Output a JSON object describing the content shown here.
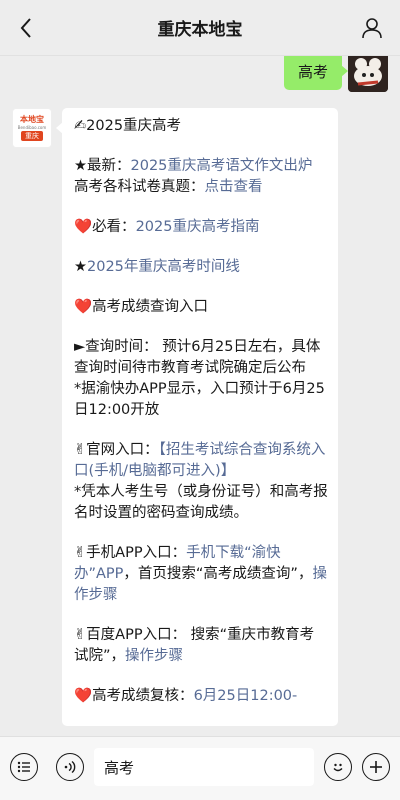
{
  "header": {
    "title": "重庆本地宝"
  },
  "user_message": {
    "text": "高考"
  },
  "bot_avatar": {
    "logo_text": "本地宝",
    "logo_site": "Bendibao.com",
    "logo_city": "重庆"
  },
  "reply": {
    "line1_icon": "✍",
    "line1": "2025重庆高考",
    "latest_prefix": "★最新：",
    "latest_link": "2025重庆高考语文作文出炉",
    "papers_prefix": "高考各科试卷真题：",
    "papers_link": "点击查看",
    "heart_icon": "❤️",
    "must_prefix": "必看：",
    "must_link": "2025重庆高考指南",
    "timeline_star": "★",
    "timeline_link": "2025年重庆高考时间线",
    "score_heading": "高考成绩查询入口",
    "query_time": "►查询时间：  预计6月25日左右，具体查询时间待市教育考试院确定后公布",
    "app_note": "*据渝快办APP显示，入口预计于6月25日12:00开放",
    "hand_icon": "✌",
    "official_prefix": "官网入口：",
    "official_link": "【招生考试综合查询系统入口(手机/电脑都可进入)】",
    "official_note": "*凭本人考生号（或身份证号）和高考报名时设置的密码查询成绩。",
    "mobile_prefix": "手机APP入口：",
    "mobile_link": "手机下载“渝快办”APP",
    "mobile_mid": "，首页搜索“高考成绩查询”，",
    "mobile_step": "操作步骤",
    "baidu_prefix": "百度APP入口：  搜索“重庆市教育考试院”，",
    "baidu_step": "操作步骤",
    "review_prefix": "高考成绩复核：",
    "review_link": "6月25日12:00-"
  },
  "input_bar": {
    "value": "高考"
  },
  "colors": {
    "background": "#ededed",
    "user_bubble": "#95ec69",
    "link": "#576b95",
    "heart": "#e02424"
  }
}
